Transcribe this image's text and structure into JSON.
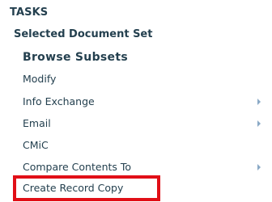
{
  "panel": {
    "section_title": "TASKS",
    "group_title": "Selected Document Set",
    "items": [
      {
        "label": "Browse Subsets",
        "has_submenu": false
      },
      {
        "label": "Modify",
        "has_submenu": false
      },
      {
        "label": "Info Exchange",
        "has_submenu": true
      },
      {
        "label": "Email",
        "has_submenu": true
      },
      {
        "label": "CMiC",
        "has_submenu": false
      },
      {
        "label": "Compare Contents To",
        "has_submenu": true
      },
      {
        "label": "Create Record Copy",
        "has_submenu": false
      }
    ],
    "highlight_color": "#E10F17",
    "text_color": "#24404F",
    "arrow_color": "#8AA9C6",
    "submenu_icon": "submenu-arrow-icon",
    "highlighted_item": "Create Record Copy"
  }
}
